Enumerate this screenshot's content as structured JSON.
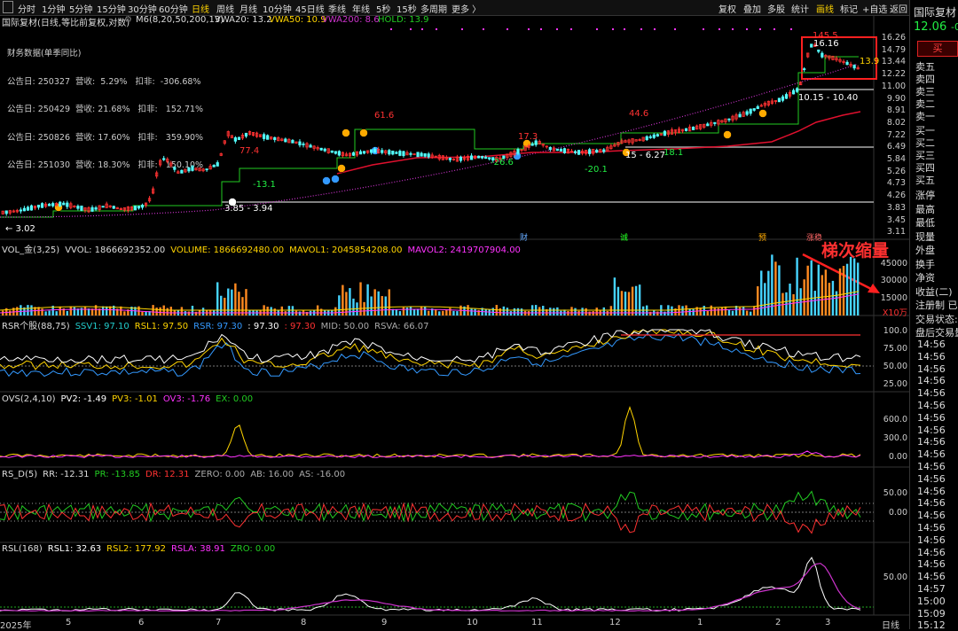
{
  "toolbar": {
    "tabs": [
      "分时",
      "1分钟",
      "5分钟",
      "15分钟",
      "30分钟",
      "60分钟",
      "日线",
      "周线",
      "月线",
      "10分钟",
      "45日线",
      "季线",
      "年线",
      "5秒",
      "15秒",
      "多周期",
      "更多 〉"
    ],
    "active_tab": "日线",
    "right_tabs": [
      "复权",
      "叠加",
      "多股",
      "统计",
      "画线",
      "标记",
      "+自选",
      "返回"
    ],
    "active_right_tab": "画线"
  },
  "info": {
    "stock_title": "国际复材(日线,等比前复权,对数)",
    "m6": "M6(8,20,50,200,13)",
    "vwa20": "VWA20: 13.2",
    "vwa50": "VWA50: 10.9",
    "vwa200": "VWA200: 8.6",
    "hold": "HOLD: 13.9"
  },
  "financial": {
    "title": "财务数据(单季同比)",
    "rows": [
      "公告日: 250327  营收:  5.29%   扣非:  -306.68%",
      "公告日: 250429  营收: 21.68%   扣非:   152.71%",
      "公告日: 250826  营收: 17.60%   扣非:   359.90%",
      "公告日: 251030  营收: 18.30%   扣非:   150.10%"
    ]
  },
  "main_axis": [
    "16.26",
    "14.79",
    "13.44",
    "12.22",
    "11.00",
    "9.90",
    "8.91",
    "8.02",
    "7.22",
    "6.49",
    "5.84",
    "5.26",
    "4.73",
    "4.26",
    "3.83",
    "3.45",
    "3.11"
  ],
  "annotations": {
    "a1": "← 3.02",
    "a2": "3.85 - 3.94",
    "a3": "77.4",
    "a4": "-13.1",
    "a5": "61.6",
    "a6": "17.3",
    "a7": "-26.6",
    "a8": "15 - 6.27",
    "a9": "-20.1",
    "a10": "44.6",
    "a11": "18.1",
    "a12": "145.5",
    "a13": "16.16",
    "a14": "13.9",
    "a15": "10.15 - 10.40",
    "m1": "财",
    "m2": "诚",
    "m3": "预",
    "m4": "涨稳"
  },
  "vol_panel": {
    "title": "VOL_金(3,25)",
    "vvol": "VVOL: 1866692352.00",
    "volume": "VOLUME: 1866692480.00",
    "mavol1": "MAVOL1: 2045854208.00",
    "mavol2": "MAVOL2: 2419707904.00",
    "axis": [
      "45000",
      "30000",
      "15000"
    ],
    "unit": "X10万",
    "callout": "梯次缩量"
  },
  "rsr_panel": {
    "title": "RSR个股(88,75)",
    "ssv1": "SSV1: 97.10",
    "rsl1": "RSL1: 97.50",
    "rsr": "RSR: 97.30",
    "v4": ": 97.30",
    "v5": ": 97.30",
    "mid": "MID: 50.00",
    "rsva": "RSVA: 66.07",
    "axis": [
      "100.0",
      "75.00",
      "50.00",
      "25.00"
    ]
  },
  "ovs_panel": {
    "title": "OVS(2,4,10)",
    "pv2": "PV2: -1.49",
    "pv3": "PV3: -1.01",
    "ov3": "OV3: -1.76",
    "ex": "EX: 0.00",
    "axis": [
      "600.0",
      "300.0",
      "0.00"
    ]
  },
  "rsd_panel": {
    "title": "RS_D(5)",
    "rr": "RR: -12.31",
    "pr": "PR: -13.85",
    "dr": "DR: 12.31",
    "zero": "ZERO: 0.00",
    "ab": "AB: 16.00",
    "as": "AS: -16.00",
    "axis": [
      "50.00",
      "0.00"
    ]
  },
  "rsl_panel": {
    "title": "RSL(168)",
    "rsl1": "RSL1: 32.63",
    "rsl2": "RSL2: 177.92",
    "rsla": "RSLA: 38.91",
    "zro": "ZRO: 0.00",
    "axis": [
      "50.00"
    ]
  },
  "x_axis": [
    "2025年",
    "5",
    "6",
    "7",
    "8",
    "9",
    "10",
    "11",
    "12",
    "1",
    "2",
    "3"
  ],
  "x_unit": "日线",
  "right_panel": {
    "name": "国际复材",
    "price": "12.06",
    "change": "-0",
    "buy": "买",
    "sell_levels": [
      "卖五",
      "卖四",
      "卖三",
      "卖二",
      "卖一"
    ],
    "buy_levels": [
      "买一",
      "买二",
      "买三",
      "买四",
      "买五"
    ],
    "stats": [
      "涨停",
      "最高",
      "最低",
      "现量",
      "外盘",
      "换手",
      "净资",
      "收益(二)",
      "注册制 已盈",
      "交易状态:",
      "盘后交易量"
    ],
    "times": [
      "14:56",
      "14:56",
      "14:56",
      "14:56",
      "14:56",
      "14:56",
      "14:56",
      "14:56",
      "14:56",
      "14:56",
      "14:56",
      "14:56",
      "14:56",
      "14:56",
      "14:56",
      "14:56",
      "14:56",
      "14:56",
      "14:56",
      "14:56",
      "14:57",
      "15:00",
      "15:09",
      "15:12"
    ]
  },
  "colors": {
    "up": "#ff3232",
    "down": "#54ffff",
    "ma_green": "#22cc22",
    "vwa200": "#cc33cc",
    "ma_red": "#e0102e",
    "yellow": "#ffd400",
    "magenta": "#ff33ff",
    "white": "#ffffff"
  }
}
